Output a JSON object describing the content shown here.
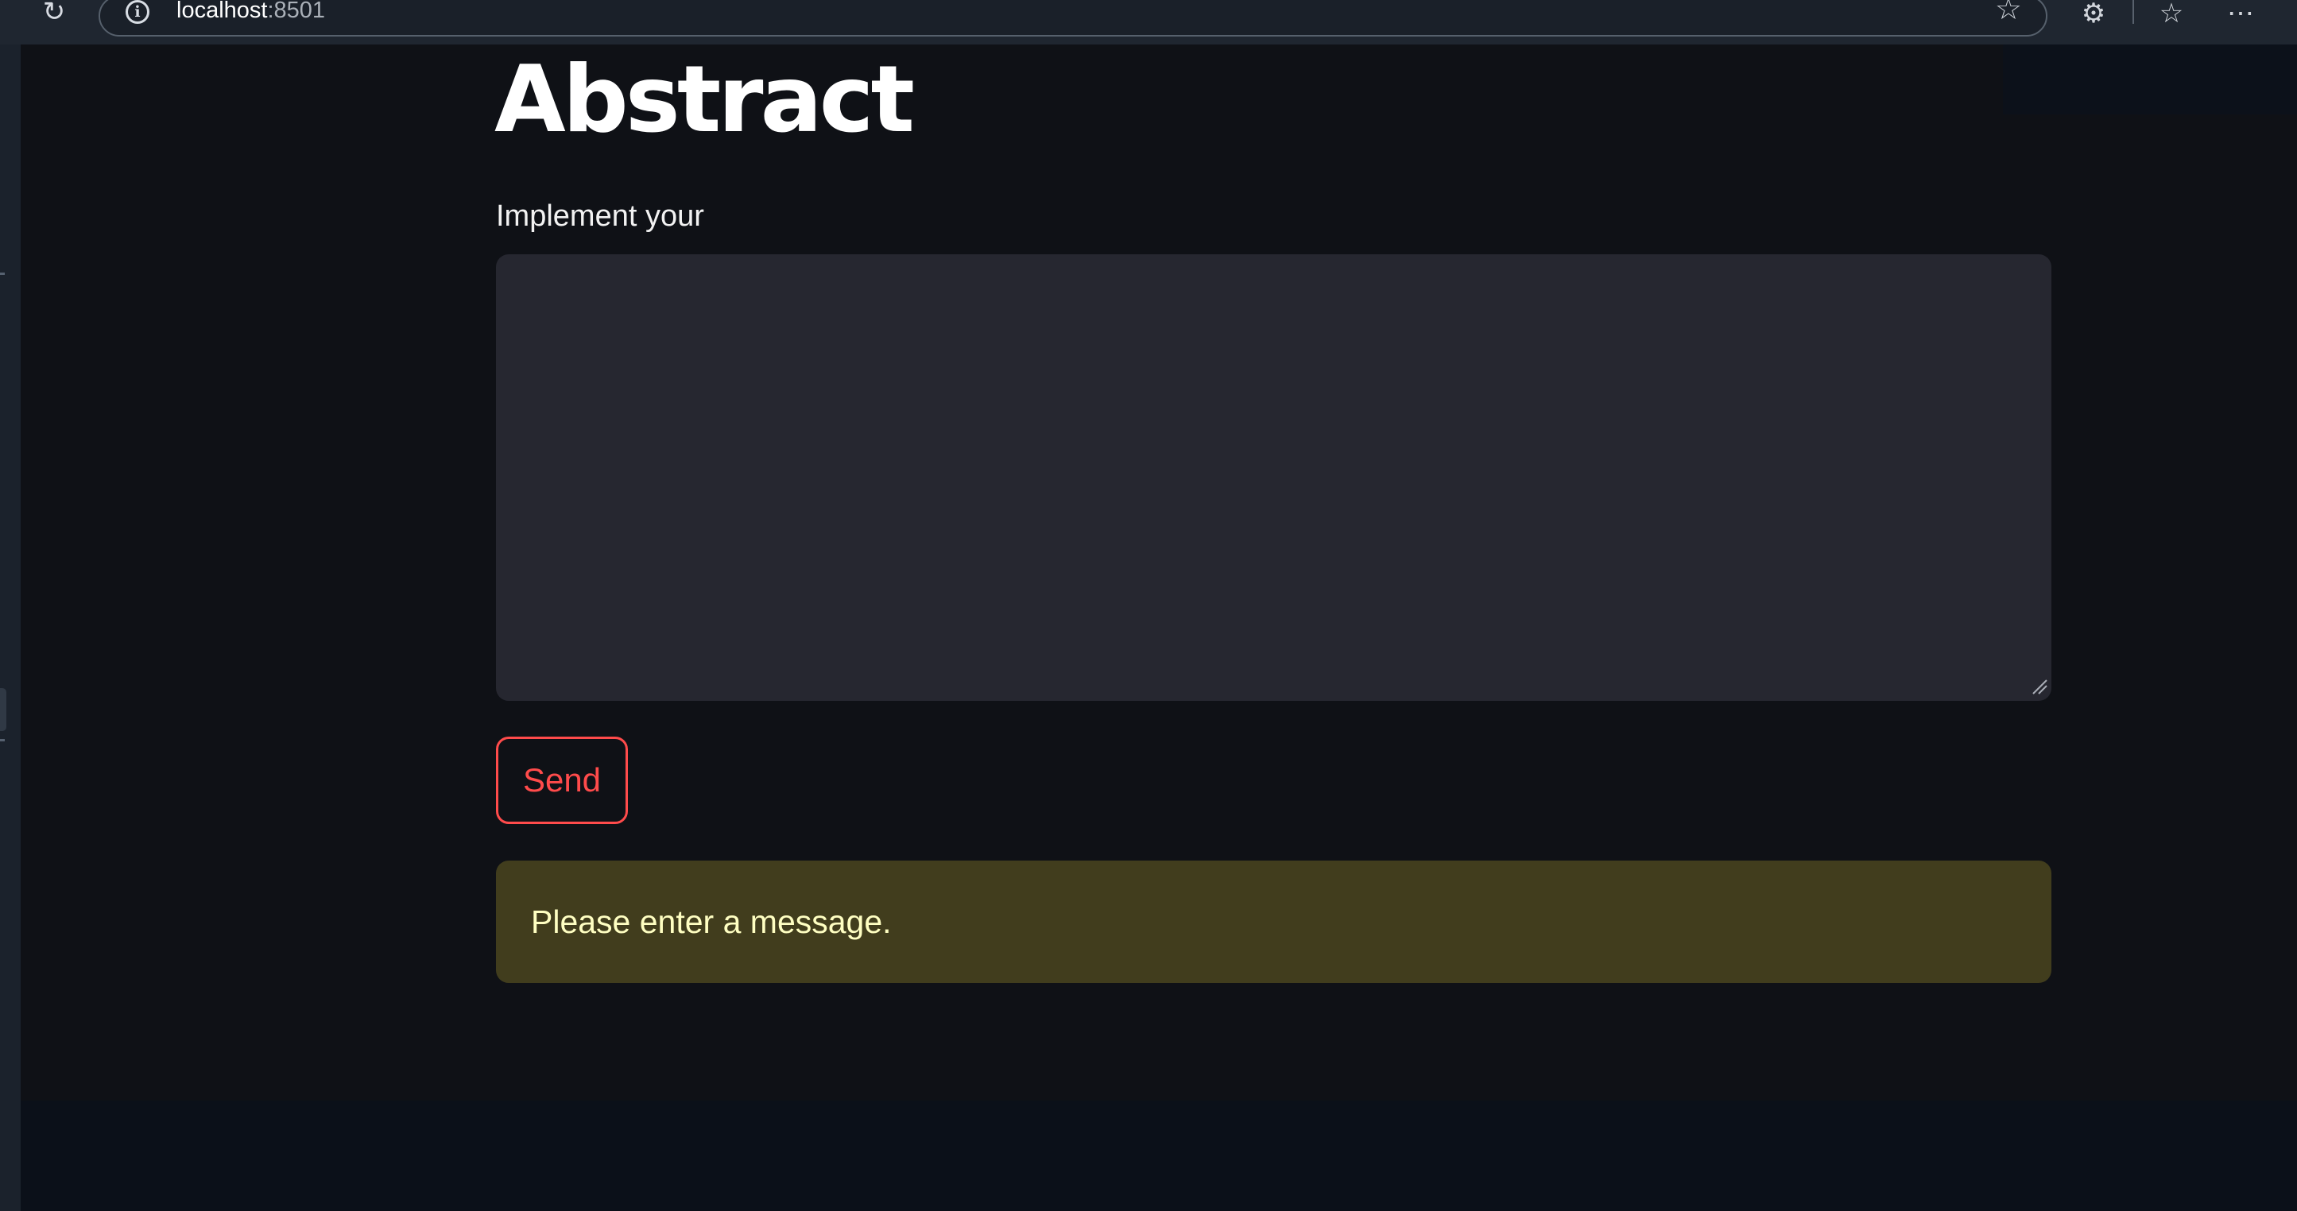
{
  "browser": {
    "address": {
      "host": "localhost",
      "port": ":8501"
    },
    "icons": [
      "reload-icon",
      "info-icon",
      "favorite-star-icon",
      "extensions-icon",
      "favorites-icon",
      "more-menu-icon"
    ]
  },
  "main": {
    "title": "Abstract",
    "input_label": "Implement your",
    "input_value": "",
    "send_label": "Send",
    "warning_text": "Please enter a message."
  },
  "colors": {
    "background": "#0e1117",
    "input_background": "#262730",
    "accent": "#ff4b4b",
    "warning_background": "#413d1d",
    "warning_text": "#ffffc2"
  }
}
